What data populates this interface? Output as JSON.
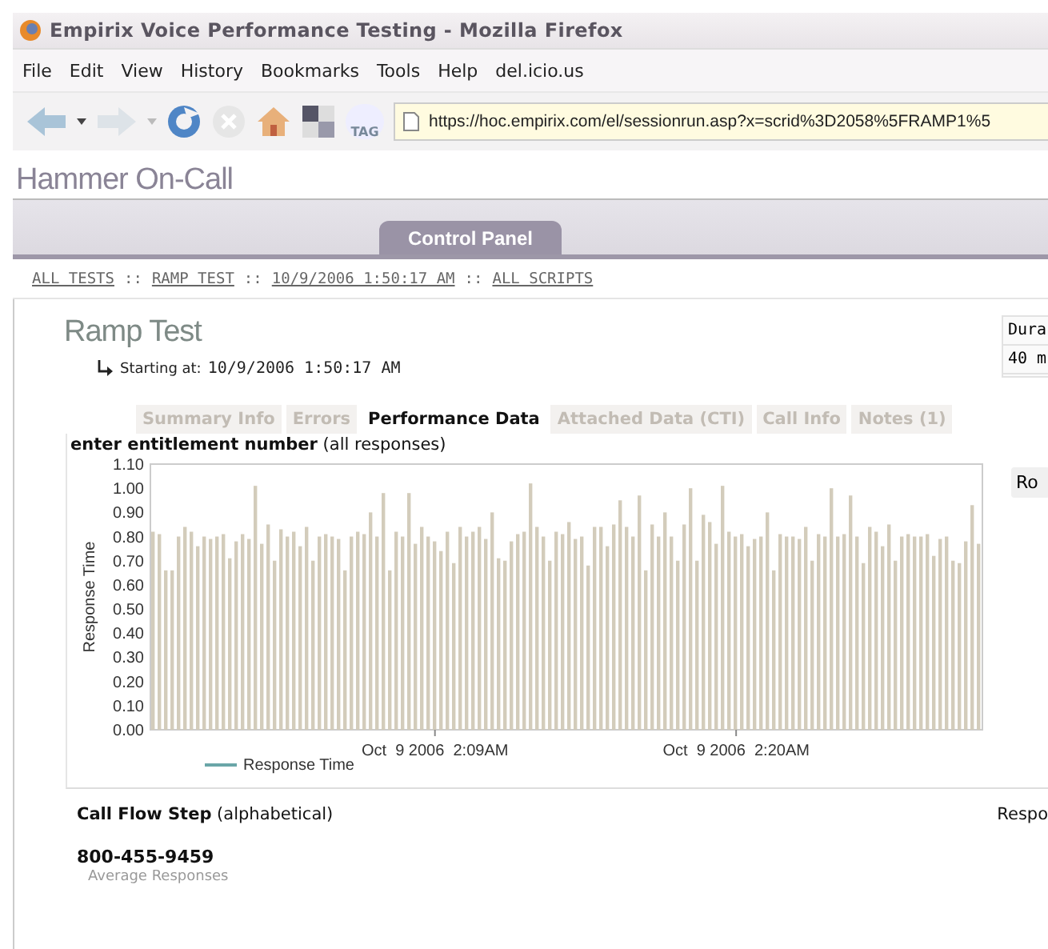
{
  "browser": {
    "title": "Empirix Voice Performance Testing - Mozilla Firefox",
    "menu": [
      "File",
      "Edit",
      "View",
      "History",
      "Bookmarks",
      "Tools",
      "Help",
      "del.icio.us"
    ],
    "toolbar": {
      "tag_label": "TAG",
      "url": "https://hoc.empirix.com/el/sessionrun.asp?x=scrid%3D2058%5FRAMP1%5"
    }
  },
  "app": {
    "title": "Hammer On-Call",
    "tabs": [
      {
        "label": "Control Panel",
        "selected": true
      }
    ]
  },
  "breadcrumb": [
    {
      "kind": "link",
      "text": "ALL TESTS"
    },
    {
      "kind": "sep",
      "text": "::"
    },
    {
      "kind": "link",
      "text": "RAMP TEST"
    },
    {
      "kind": "sep",
      "text": "::"
    },
    {
      "kind": "link",
      "text": "10/9/2006 1:50:17 AM"
    },
    {
      "kind": "sep",
      "text": "::"
    },
    {
      "kind": "link",
      "text": "ALL SCRIPTS"
    }
  ],
  "test": {
    "title": "Ramp Test",
    "starting_label": "Starting at:",
    "start_time": "10/9/2006 1:50:17 AM"
  },
  "summary_box": {
    "label": "Dura",
    "value": "40 m"
  },
  "detail_tabs": [
    {
      "label": "Summary Info",
      "selected": false
    },
    {
      "label": "Errors",
      "selected": false
    },
    {
      "label": "Performance Data",
      "selected": true
    },
    {
      "label": "Attached Data (CTI)",
      "selected": false
    },
    {
      "label": "Call Info",
      "selected": false
    },
    {
      "label": "Notes (1)",
      "selected": false
    }
  ],
  "chart": {
    "title": "enter entitlement number",
    "subtitle": "(all responses)",
    "side_button": "Ro",
    "time_labels": [
      "Oct  9 2006  2:09AM",
      "Oct  9 2006  2:20AM"
    ],
    "chart_data": {
      "type": "bar",
      "ylabel": "Response Time",
      "ylim": [
        0,
        1.1
      ],
      "yticks": [
        {
          "value": 0,
          "label": "0.00"
        },
        {
          "value": 0.1,
          "label": "0.10"
        },
        {
          "value": 0.2,
          "label": "0.20"
        },
        {
          "value": 0.3,
          "label": "0.30"
        },
        {
          "value": 0.4,
          "label": "0.40"
        },
        {
          "value": 0.5,
          "label": "0.50"
        },
        {
          "value": 0.6,
          "label": "0.60"
        },
        {
          "value": 0.7,
          "label": "0.70"
        },
        {
          "value": 0.8,
          "label": "0.80"
        },
        {
          "value": 0.9,
          "label": "0.90"
        },
        {
          "value": 1.0,
          "label": "1.00"
        },
        {
          "value": 1.1,
          "label": "1.10"
        }
      ],
      "series": [
        {
          "name": "Response Time",
          "color": "#d3ccbb",
          "values": [
            0.82,
            0.81,
            0.66,
            0.66,
            0.8,
            0.84,
            0.82,
            0.76,
            0.8,
            0.79,
            0.8,
            0.81,
            0.71,
            0.78,
            0.81,
            0.79,
            1.01,
            0.77,
            0.85,
            0.7,
            0.83,
            0.8,
            0.82,
            0.76,
            0.84,
            0.7,
            0.8,
            0.81,
            0.8,
            0.79,
            0.66,
            0.8,
            0.82,
            0.81,
            0.9,
            0.8,
            0.98,
            0.66,
            0.82,
            0.8,
            0.98,
            0.77,
            0.84,
            0.8,
            0.78,
            0.74,
            0.82,
            0.69,
            0.84,
            0.8,
            0.82,
            0.84,
            0.79,
            0.9,
            0.71,
            0.7,
            0.78,
            0.81,
            0.82,
            1.02,
            0.84,
            0.8,
            0.7,
            0.82,
            0.81,
            0.86,
            0.79,
            0.8,
            0.68,
            0.84,
            0.84,
            0.76,
            0.85,
            0.95,
            0.84,
            0.8,
            0.97,
            0.66,
            0.85,
            0.8,
            0.9,
            0.8,
            0.7,
            0.85,
            1.0,
            0.7,
            0.89,
            0.86,
            0.77,
            1.01,
            0.82,
            0.8,
            0.81,
            0.76,
            0.79,
            0.8,
            0.9,
            0.66,
            0.81,
            0.8,
            0.8,
            0.79,
            0.84,
            0.7,
            0.81,
            0.8,
            1.0,
            0.8,
            0.81,
            0.97,
            0.8,
            0.69,
            0.84,
            0.82,
            0.76,
            0.85,
            0.7,
            0.8,
            0.81,
            0.8,
            0.8,
            0.81,
            0.72,
            0.79,
            0.8,
            0.7,
            0.69,
            0.78,
            0.93,
            0.77
          ]
        }
      ]
    }
  },
  "steps": {
    "heading": "Call Flow Step",
    "heading_note": "(alphabetical)",
    "column_2": "Respo",
    "items": [
      {
        "name": "800-455-9459",
        "detail": "Average Responses"
      }
    ]
  }
}
